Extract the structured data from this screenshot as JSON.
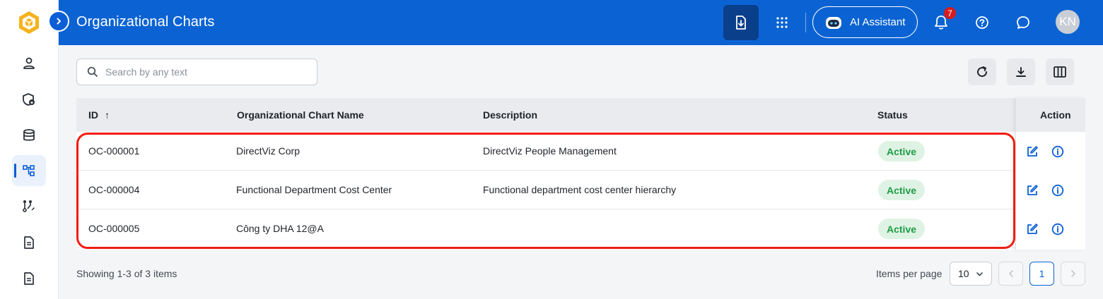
{
  "header": {
    "title": "Organizational Charts",
    "ai_assistant_label": "AI Assistant",
    "notification_count": "7",
    "avatar_initials": "KN"
  },
  "sidebar": {
    "items": [
      {
        "icon": "user-icon"
      },
      {
        "icon": "shield-lock-icon"
      },
      {
        "icon": "database-icon"
      },
      {
        "icon": "org-chart-icon",
        "active": true
      },
      {
        "icon": "workflow-icon"
      },
      {
        "icon": "document-icon"
      },
      {
        "icon": "document-icon"
      }
    ]
  },
  "search": {
    "placeholder": "Search by any text",
    "value": ""
  },
  "table": {
    "columns": {
      "id": "ID",
      "name": "Organizational Chart Name",
      "description": "Description",
      "status": "Status",
      "action": "Action"
    },
    "sort_indicator": "↑",
    "rows": [
      {
        "id": "OC-000001",
        "name": "DirectViz Corp",
        "description": "DirectViz People Management",
        "status": "Active"
      },
      {
        "id": "OC-000004",
        "name": "Functional Department Cost Center",
        "description": "Functional department cost center hierarchy",
        "status": "Active"
      },
      {
        "id": "OC-000005",
        "name": "Công ty DHA 12@A",
        "description": "",
        "status": "Active"
      }
    ]
  },
  "footer": {
    "showing": "Showing 1-3 of 3 items",
    "items_per_page_label": "Items per page",
    "items_per_page_value": "10",
    "current_page": "1"
  },
  "colors": {
    "brand": "#0b63d3",
    "status_active_bg": "#dff3e4",
    "status_active_text": "#1e9b46",
    "highlight": "#f21d10"
  }
}
